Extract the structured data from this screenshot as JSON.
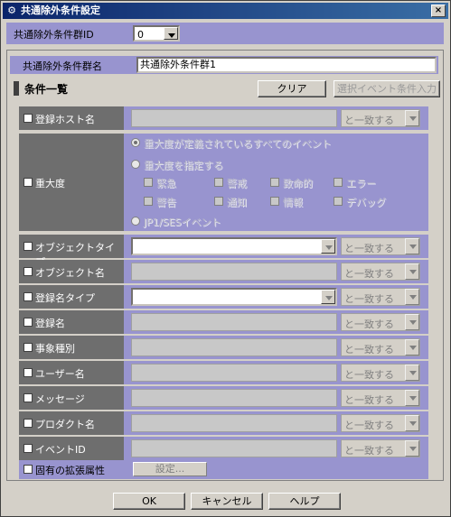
{
  "window": {
    "title": "共通除外条件設定",
    "close_label": "×"
  },
  "group_id": {
    "label": "共通除外条件群ID",
    "value": "0"
  },
  "group_name": {
    "label": "共通除外条件群名",
    "value": "共通除外条件群1"
  },
  "conditions": {
    "title": "条件一覧",
    "clear_label": "クリア",
    "select_event_label": "選択イベント条件入力"
  },
  "rows": [
    {
      "label": "登録ホスト名",
      "match": "と一致する"
    },
    {
      "label": "重大度"
    },
    {
      "label": "オブジェクトタイプ",
      "match": "と一致する"
    },
    {
      "label": "オブジェクト名",
      "match": "と一致する"
    },
    {
      "label": "登録名タイプ",
      "match": "と一致する"
    },
    {
      "label": "登録名",
      "match": "と一致する"
    },
    {
      "label": "事象種別",
      "match": "と一致する"
    },
    {
      "label": "ユーザー名",
      "match": "と一致する"
    },
    {
      "label": "メッセージ",
      "match": "と一致する"
    },
    {
      "label": "プロダクト名",
      "match": "と一致する"
    },
    {
      "label": "イベントID",
      "match": "と一致する"
    },
    {
      "label": "固有の拡張属性",
      "button": "設定..."
    }
  ],
  "severity": {
    "radio_all": "重大度が定義されているすべてのイベント",
    "radio_specify": "重大度を指定する",
    "radio_jp1": "JP1/SESイベント",
    "levels": [
      "緊急",
      "警戒",
      "致命的",
      "エラー",
      "警告",
      "通知",
      "情報",
      "デバッグ"
    ]
  },
  "footer": {
    "ok": "OK",
    "cancel": "キャンセル",
    "help": "ヘルプ"
  }
}
